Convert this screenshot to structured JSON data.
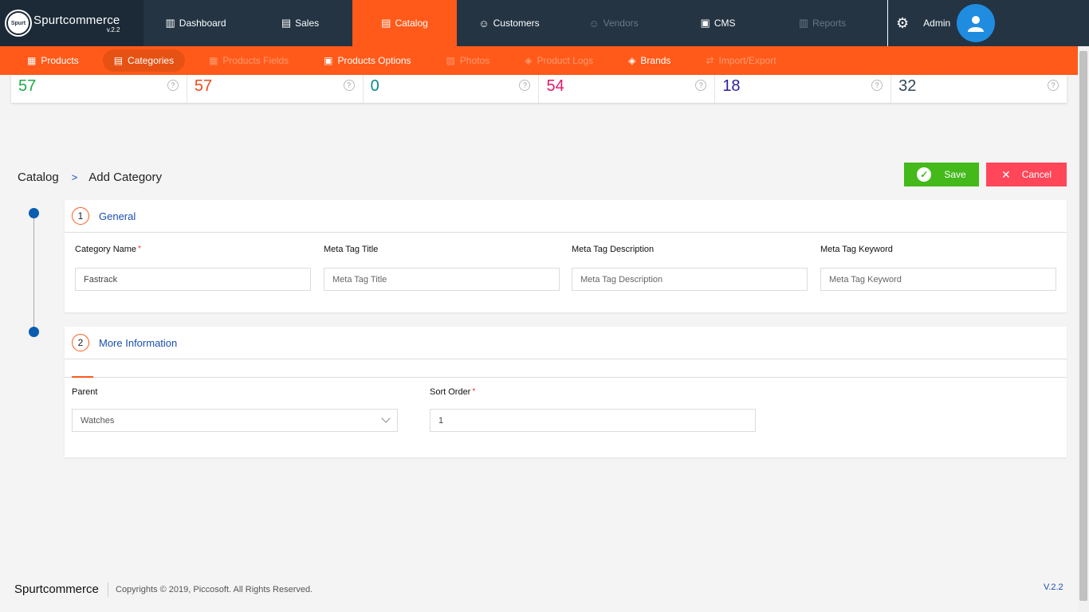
{
  "brand": {
    "name": "Spurtcommerce",
    "version": "v.2.2",
    "logo_text": "Spurt"
  },
  "topnav": [
    {
      "label": "Dashboard",
      "icon": "bar-chart-icon",
      "glyph": "▥",
      "state": "normal"
    },
    {
      "label": "Sales",
      "icon": "clipboard-icon",
      "glyph": "▤",
      "state": "normal"
    },
    {
      "label": "Catalog",
      "icon": "clipboard-list-icon",
      "glyph": "▤",
      "state": "active"
    },
    {
      "label": "Customers",
      "icon": "customer-icon",
      "glyph": "☺",
      "state": "normal"
    },
    {
      "label": "Vendors",
      "icon": "user-icon",
      "glyph": "☺",
      "state": "disabled"
    },
    {
      "label": "CMS",
      "icon": "cms-icon",
      "glyph": "▣",
      "state": "normal"
    },
    {
      "label": "Reports",
      "icon": "report-chart-icon",
      "glyph": "▥",
      "state": "disabled"
    }
  ],
  "admin": {
    "label": "Admin"
  },
  "subnav": [
    {
      "label": "Products",
      "icon": "products-icon",
      "glyph": "▦",
      "state": "normal"
    },
    {
      "label": "Categories",
      "icon": "categories-icon",
      "glyph": "▤",
      "state": "active"
    },
    {
      "label": "Products Fields",
      "icon": "product-fields-icon",
      "glyph": "▦",
      "state": "disabled"
    },
    {
      "label": "Products Options",
      "icon": "product-options-icon",
      "glyph": "▣",
      "state": "normal"
    },
    {
      "label": "Photos",
      "icon": "photo-icon",
      "glyph": "▨",
      "state": "disabled"
    },
    {
      "label": "Product Logs",
      "icon": "box-icon",
      "glyph": "◈",
      "state": "disabled"
    },
    {
      "label": "Brands",
      "icon": "layers-icon",
      "glyph": "◈",
      "state": "normal"
    },
    {
      "label": "Import/Export",
      "icon": "cart-icon",
      "glyph": "⇄",
      "state": "disabled"
    }
  ],
  "stats": [
    {
      "value": "57",
      "color": "#1fab4a"
    },
    {
      "value": "57",
      "color": "#f04a1a"
    },
    {
      "value": "0",
      "color": "#0a8a8a"
    },
    {
      "value": "54",
      "color": "#e6176a"
    },
    {
      "value": "18",
      "color": "#2b1ea0"
    },
    {
      "value": "32",
      "color": "#33475b"
    }
  ],
  "stat_help_glyph": "?",
  "breadcrumb": {
    "root": "Catalog",
    "separator": ">",
    "current": "Add Category"
  },
  "actions": {
    "save": "Save",
    "cancel": "Cancel",
    "save_glyph": "✓",
    "cancel_glyph": "✕"
  },
  "general": {
    "step": "1",
    "title": "General",
    "fields": [
      {
        "label": "Category Name",
        "required": true,
        "value": "Fastrack",
        "placeholder": ""
      },
      {
        "label": "Meta Tag Title",
        "required": false,
        "value": "",
        "placeholder": "Meta Tag Title"
      },
      {
        "label": "Meta Tag Description",
        "required": false,
        "value": "",
        "placeholder": "Meta Tag Description"
      },
      {
        "label": "Meta Tag Keyword",
        "required": false,
        "value": "",
        "placeholder": "Meta Tag Keyword"
      }
    ]
  },
  "more_info": {
    "step": "2",
    "title": "More Information",
    "parent_label": "Parent",
    "parent_value": "Watches",
    "sort_label": "Sort Order",
    "sort_value": "1"
  },
  "required_mark": "*",
  "footer": {
    "brand": "Spurtcommerce",
    "copyright": "Copyrights © 2019, Piccosoft. All Rights Reserved.",
    "version": "V.2.2"
  },
  "colors": {
    "accent": "#ff5a1a",
    "topbar": "#243443",
    "save": "#43b91a",
    "cancel": "#ff4759",
    "link": "#1a4fb0"
  }
}
